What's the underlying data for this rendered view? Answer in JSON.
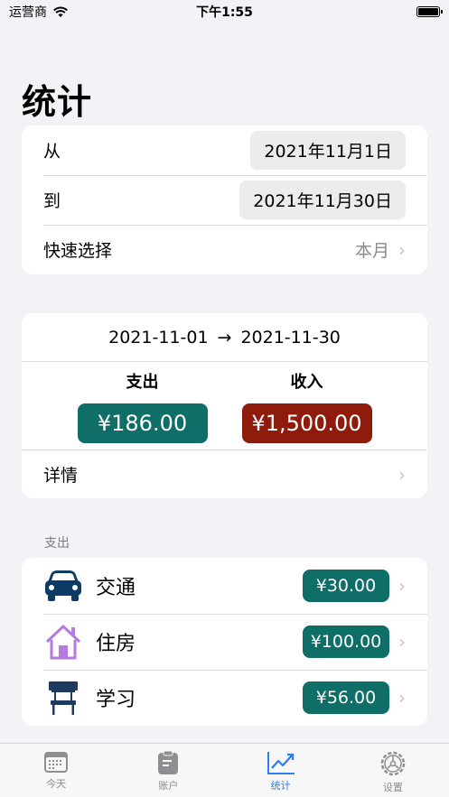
{
  "status_bar": {
    "carrier": "运营商",
    "time": "下午1:55"
  },
  "page_title": "统计",
  "date_range": {
    "from_label": "从",
    "from_value": "2021年11月1日",
    "to_label": "到",
    "to_value": "2021年11月30日",
    "quick_label": "快速选择",
    "quick_value": "本月"
  },
  "summary": {
    "start": "2021-11-01",
    "arrow": "→",
    "end": "2021-11-30",
    "expense_label": "支出",
    "expense_value": "¥186.00",
    "income_label": "收入",
    "income_value": "¥1,500.00",
    "detail_label": "详情",
    "colors": {
      "expense": "#0f6e67",
      "income": "#8e1b0c"
    }
  },
  "expense_section": {
    "title": "支出",
    "items": [
      {
        "name": "交通",
        "amount": "¥30.00",
        "icon": "car-icon"
      },
      {
        "name": "住房",
        "amount": "¥100.00",
        "icon": "house-icon"
      },
      {
        "name": "学习",
        "amount": "¥56.00",
        "icon": "desk-icon"
      }
    ]
  },
  "tabs": [
    {
      "label": "今天",
      "icon": "calendar-icon",
      "active": false
    },
    {
      "label": "账户",
      "icon": "clipboard-icon",
      "active": false
    },
    {
      "label": "统计",
      "icon": "chart-icon",
      "active": true
    },
    {
      "label": "设置",
      "icon": "gear-icon",
      "active": false
    }
  ],
  "colors": {
    "accent": "#2f7cf6",
    "amount_pill": "#0f6e67"
  }
}
